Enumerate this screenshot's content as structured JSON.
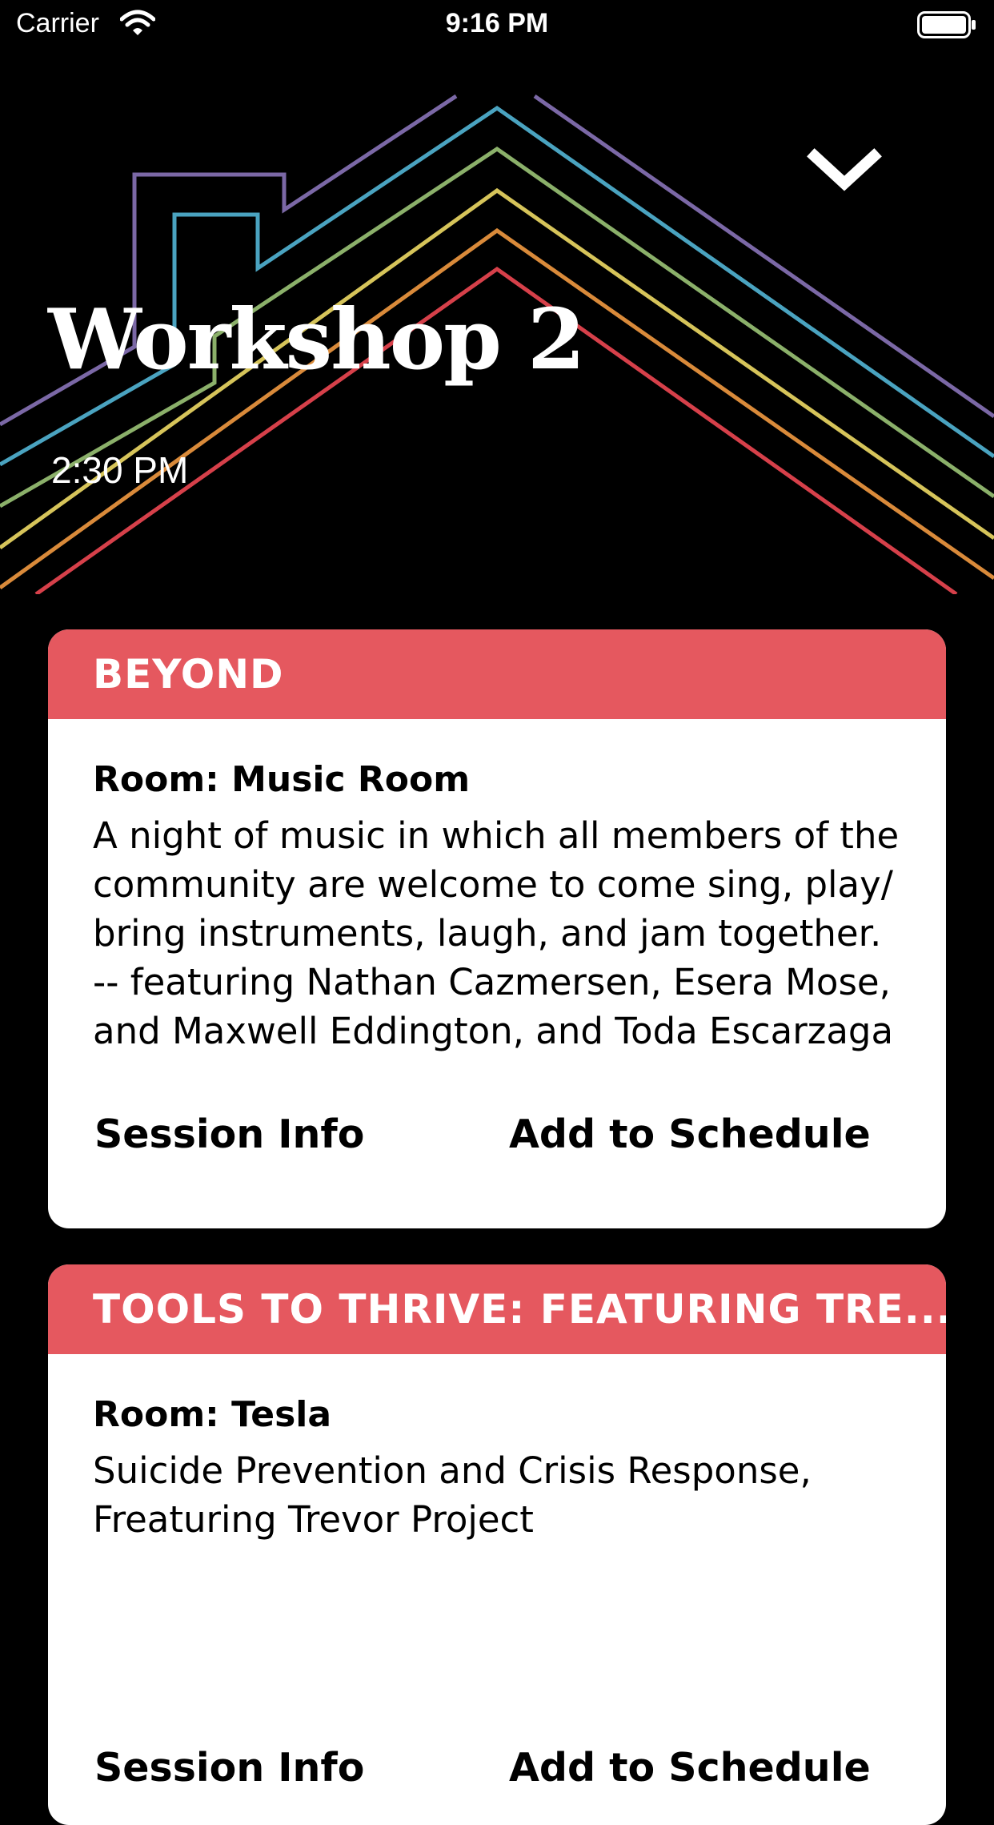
{
  "status_bar": {
    "carrier": "Carrier",
    "time": "9:16 PM"
  },
  "header": {
    "title": "Workshop 2",
    "time": "2:30 PM",
    "collapse_icon": "chevron-down-icon",
    "art_colors": [
      "#7b68a6",
      "#4aa3c0",
      "#8bb06a",
      "#d6c45a",
      "#d98a3a",
      "#d6404a"
    ]
  },
  "sessions": [
    {
      "title": "BEYOND",
      "room": "Room: Music Room",
      "description": "A night of music in which all members of the community are welcome to come sing, play/ bring instruments, laugh, and jam together. -- featuring Nathan Cazmersen, Esera Mose, and Maxwell Eddington, and Toda Escarzaga",
      "info_label": "Session Info",
      "add_label": "Add to Schedule"
    },
    {
      "title": "TOOLS TO THRIVE: FEATURING TRE...",
      "room": "Room: Tesla",
      "description": "Suicide Prevention and Crisis Response, Freaturing Trevor Project",
      "info_label": "Session Info",
      "add_label": "Add to Schedule"
    }
  ],
  "colors": {
    "background": "#000000",
    "card_header": "#e5585f",
    "card_body": "#ffffff"
  }
}
